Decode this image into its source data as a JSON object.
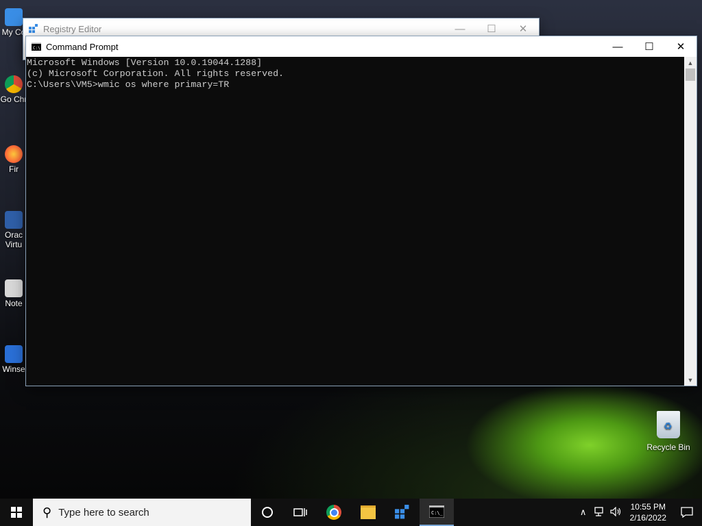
{
  "desktop": {
    "icons": [
      {
        "label": "My Co",
        "name": "my-computer",
        "color": "#3a8ee6"
      },
      {
        "label": "Go Chr",
        "name": "google-chrome",
        "color": "#dd4b39"
      },
      {
        "label": "Fir",
        "name": "firefox",
        "color": "#ff7139"
      },
      {
        "label": "Orac Virtu",
        "name": "oracle-virtualbox",
        "color": "#2f5fa8"
      },
      {
        "label": "Note",
        "name": "notepad",
        "color": "#d8d8d8"
      },
      {
        "label": "Winse",
        "name": "winscp",
        "color": "#2a6fd6"
      }
    ],
    "recycle_bin": "Recycle Bin"
  },
  "regedit": {
    "title": "Registry Editor"
  },
  "cmd": {
    "title": "Command Prompt",
    "lines": [
      "Microsoft Windows [Version 10.0.19044.1288]",
      "(c) Microsoft Corporation. All rights reserved.",
      "",
      "C:\\Users\\VM5>wmic os where primary=TR"
    ]
  },
  "window_controls": {
    "minimize": "—",
    "maximize": "☐",
    "close": "✕"
  },
  "taskbar": {
    "search_placeholder": "Type here to search",
    "time": "10:55 PM",
    "date": "2/16/2022"
  },
  "colors": {
    "console_bg": "#0c0c0c",
    "console_fg": "#cccccc",
    "taskbar": "#101010"
  }
}
